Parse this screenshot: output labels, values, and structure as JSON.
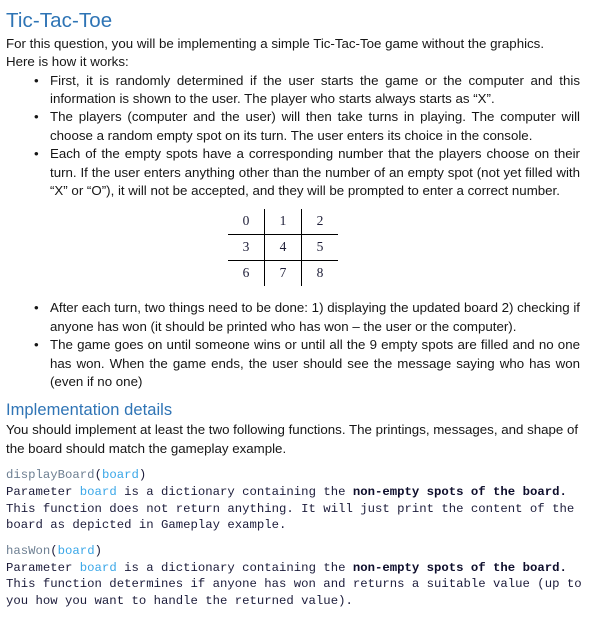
{
  "document": {
    "title": "Tic-Tac-Toe",
    "intro": {
      "line1": "For this question, you will be implementing a simple Tic-Tac-Toe game without the graphics.",
      "line2": "Here is how it works:"
    },
    "bullet_marker": "•",
    "bullets_top": [
      "First, it is randomly determined if the user starts the game or the computer and this information is shown to the user. The player who starts always starts as “X”.",
      "The players (computer and the user) will then take turns in playing. The computer will choose a random empty spot on its turn. The user enters its choice in the console.",
      "Each of the empty spots have a corresponding number that the players choose on their turn. If the user enters anything other than the number of an empty spot (not yet filled with “X” or “O”), it will not be accepted, and they will be prompted to enter a correct number."
    ],
    "board_grid": {
      "rows": [
        [
          "0",
          "1",
          "2"
        ],
        [
          "3",
          "4",
          "5"
        ],
        [
          "6",
          "7",
          "8"
        ]
      ]
    },
    "bullets_bottom": [
      "After each turn, two things need to be done: 1) displaying the updated board 2) checking if anyone has won (it should be printed who has won – the user or the computer).",
      "The game goes on until someone wins or until all the 9 empty spots are filled and no one has won. When the game ends, the user should see the message saying who has won (even if no one)"
    ],
    "implementation": {
      "heading": "Implementation details",
      "description": "You should implement at least the two following functions. The printings, messages, and shape of the board should match the gameplay example.",
      "functions": [
        {
          "name": "displayBoard",
          "open_paren": "(",
          "arg": "board",
          "close_paren": ")",
          "desc_part1": "Parameter ",
          "desc_arg": "board",
          "desc_part2": " is a dictionary containing the ",
          "desc_bold": "non-empty spots of the board.",
          "desc_part3": " This function does not return anything. It will just print the content of the board as depicted in Gameplay example."
        },
        {
          "name": "hasWon",
          "open_paren": "(",
          "arg": "board",
          "close_paren": ")",
          "desc_part1": "Parameter ",
          "desc_arg": "board",
          "desc_part2": " is a dictionary containing the ",
          "desc_bold": "non-empty spots of the board.",
          "desc_part3": " This function determines if anyone has won and returns a suitable value (up to you how you want to handle the returned value)."
        }
      ]
    },
    "colors": {
      "heading_blue": "#2E74B5",
      "body_black": "#161616",
      "code_navy": "#1B1B3A",
      "code_arg_cyan": "#3AA7E8",
      "code_fn_gray": "#6D7F92",
      "grid_line": "#000000"
    }
  }
}
